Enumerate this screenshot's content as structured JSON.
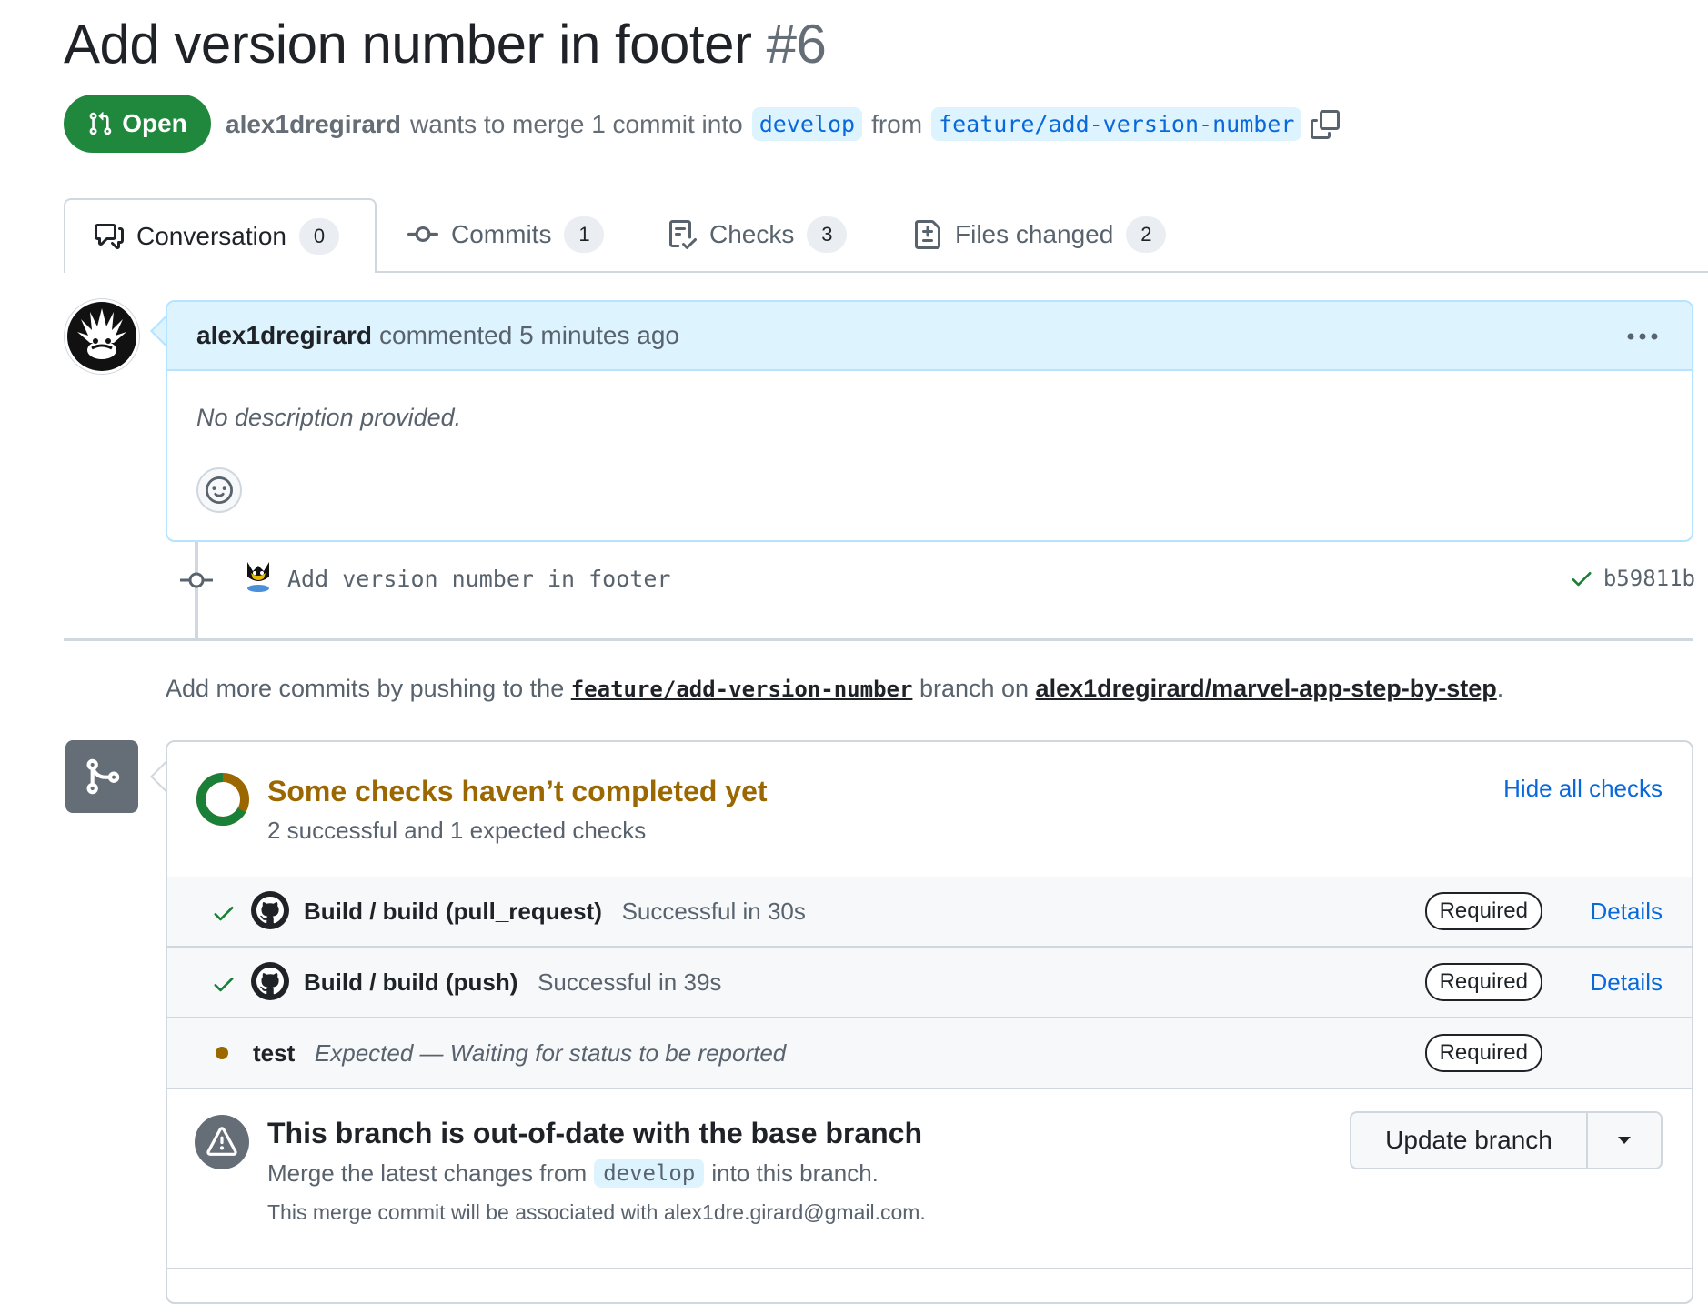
{
  "pr": {
    "title": "Add version number in footer",
    "number": "#6",
    "status": "Open",
    "author": "alex1dregirard",
    "merge_text": "wants to merge 1 commit into",
    "base_branch": "develop",
    "from_text": "from",
    "head_branch": "feature/add-version-number"
  },
  "tabs": [
    {
      "label": "Conversation",
      "count": "0"
    },
    {
      "label": "Commits",
      "count": "1"
    },
    {
      "label": "Checks",
      "count": "3"
    },
    {
      "label": "Files changed",
      "count": "2"
    }
  ],
  "comment": {
    "author": "alex1dregirard",
    "meta": "commented 5 minutes ago",
    "body": "No description provided."
  },
  "commit": {
    "message": "Add version number in footer",
    "sha": "b59811b"
  },
  "push_hint": {
    "prefix": "Add more commits by pushing to the",
    "branch": "feature/add-version-number",
    "middle": "branch on",
    "repo": "alex1dregirard/marvel-app-step-by-step",
    "suffix": "."
  },
  "checks": {
    "title": "Some checks haven’t completed yet",
    "subtitle": "2 successful and 1 expected checks",
    "hide_label": "Hide all checks",
    "successful": 2,
    "total": 3,
    "rows": [
      {
        "name": "Build / build (pull_request)",
        "desc": "Successful in 30s",
        "badge": "Required",
        "details": "Details"
      },
      {
        "name": "Build / build (push)",
        "desc": "Successful in 39s",
        "badge": "Required",
        "details": "Details"
      },
      {
        "name": "test",
        "desc": "Expected — Waiting for status to be reported",
        "badge": "Required"
      }
    ]
  },
  "outdated": {
    "title": "This branch is out-of-date with the base branch",
    "sub_prefix": "Merge the latest changes from",
    "sub_branch": "develop",
    "sub_suffix": "into this branch.",
    "note": "This merge commit will be associated with alex1dre.girard@gmail.com.",
    "button": "Update branch"
  },
  "colors": {
    "open_green": "#1f883d",
    "link_blue": "#0969da",
    "pending_amber": "#9a6700"
  }
}
